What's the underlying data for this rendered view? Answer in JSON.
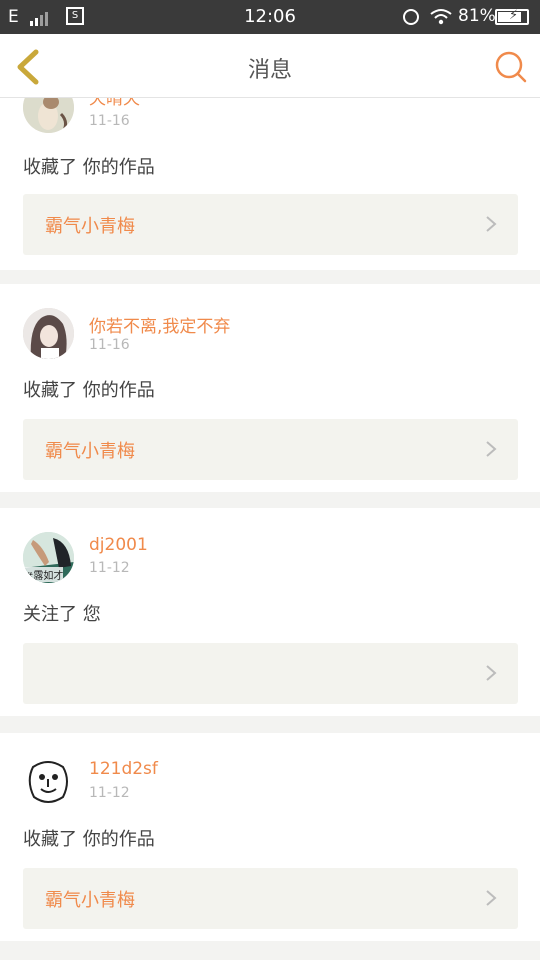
{
  "status_bar": {
    "carrier": "E",
    "screenshot_glyph": "S",
    "time": "12:06",
    "battery_percent": "81%",
    "battery_level": 0.81,
    "icons": [
      "signal-icon",
      "screenshot-icon",
      "alarm-icon",
      "wifi-icon",
      "battery-icon"
    ]
  },
  "header": {
    "title": "消息",
    "back_icon": "chevron-left-icon",
    "search_icon": "search-icon"
  },
  "colors": {
    "accent": "#f08a4b",
    "back_arrow": "#c9a83a",
    "work_box_bg": "#f3f3ee",
    "page_bg": "#f3f3f1"
  },
  "messages": [
    {
      "username": "天晴天",
      "date": "11-16",
      "action": "收藏了 你的作品",
      "work_title": "霸气小青梅"
    },
    {
      "username": "你若不离,我定不弃",
      "date": "11-16",
      "action": "收藏了 你的作品",
      "work_title": "霸气小青梅"
    },
    {
      "username": "dj2001",
      "date": "11-12",
      "action": "关注了 您",
      "work_title": "",
      "avatar_text": "#露如才"
    },
    {
      "username": "121d2sf",
      "date": "11-12",
      "action": "收藏了 你的作品",
      "work_title": "霸气小青梅"
    }
  ]
}
